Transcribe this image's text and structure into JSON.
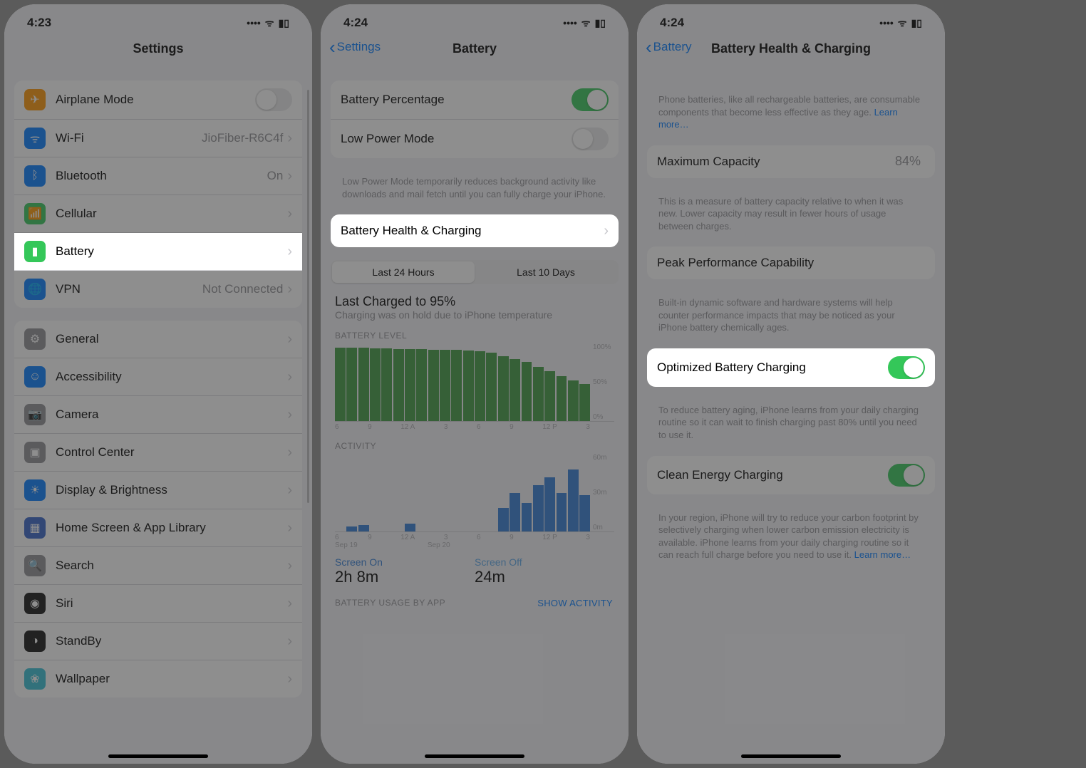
{
  "screen1": {
    "time": "4:23",
    "title": "Settings",
    "group1": [
      {
        "name": "airplane",
        "label": "Airplane Mode",
        "iconBg": "#ff9500",
        "glyph": "✈",
        "type": "toggle",
        "on": false
      },
      {
        "name": "wifi",
        "label": "Wi-Fi",
        "iconBg": "#007aff",
        "glyph": "ᯤ",
        "value": "JioFiber-R6C4f"
      },
      {
        "name": "bluetooth",
        "label": "Bluetooth",
        "iconBg": "#007aff",
        "glyph": "ᛒ",
        "value": "On"
      },
      {
        "name": "cellular",
        "label": "Cellular",
        "iconBg": "#34c759",
        "glyph": "📶"
      },
      {
        "name": "battery",
        "label": "Battery",
        "iconBg": "#34c759",
        "glyph": "▮",
        "highlight": true
      },
      {
        "name": "vpn",
        "label": "VPN",
        "iconBg": "#007aff",
        "glyph": "🌐",
        "value": "Not Connected"
      }
    ],
    "group2": [
      {
        "name": "general",
        "label": "General",
        "iconBg": "#8e8e93",
        "glyph": "⚙"
      },
      {
        "name": "accessibility",
        "label": "Accessibility",
        "iconBg": "#007aff",
        "glyph": "☺"
      },
      {
        "name": "camera",
        "label": "Camera",
        "iconBg": "#8e8e93",
        "glyph": "📷"
      },
      {
        "name": "control-center",
        "label": "Control Center",
        "iconBg": "#8e8e93",
        "glyph": "▣"
      },
      {
        "name": "display",
        "label": "Display & Brightness",
        "iconBg": "#007aff",
        "glyph": "☀"
      },
      {
        "name": "home-screen",
        "label": "Home Screen & App Library",
        "iconBg": "#3463c7",
        "glyph": "▦"
      },
      {
        "name": "search",
        "label": "Search",
        "iconBg": "#8e8e93",
        "glyph": "🔍"
      },
      {
        "name": "siri",
        "label": "Siri",
        "iconBg": "#111",
        "glyph": "◉"
      },
      {
        "name": "standby",
        "label": "StandBy",
        "iconBg": "#111",
        "glyph": "◑"
      },
      {
        "name": "wallpaper",
        "label": "Wallpaper",
        "iconBg": "#33bed4",
        "glyph": "❀"
      }
    ]
  },
  "screen2": {
    "time": "4:24",
    "back": "Settings",
    "title": "Battery",
    "rows": {
      "percentage": "Battery Percentage",
      "lowpower": "Low Power Mode",
      "lowpower_desc": "Low Power Mode temporarily reduces background activity like downloads and mail fetch until you can fully charge your iPhone.",
      "health": "Battery Health & Charging"
    },
    "segments": {
      "a": "Last 24 Hours",
      "b": "Last 10 Days"
    },
    "charge_head": "Last Charged to 95%",
    "charge_sub": "Charging was on hold due to iPhone temperature",
    "label_level": "BATTERY LEVEL",
    "label_activity": "ACTIVITY",
    "xticks": [
      "6",
      "9",
      "12 A",
      "3",
      "6",
      "9",
      "12 P",
      "3"
    ],
    "xticks2": [
      "6",
      "9",
      "12 A",
      "3",
      "6",
      "9",
      "12 P",
      "3"
    ],
    "xsub": [
      "Sep 19",
      "Sep 20"
    ],
    "y_level": [
      "100%",
      "50%",
      "0%"
    ],
    "y_act": [
      "60m",
      "30m",
      "0m"
    ],
    "screen_on_k": "Screen On",
    "screen_on_v": "2h 8m",
    "screen_off_k": "Screen Off",
    "screen_off_v": "24m",
    "usage_label": "BATTERY USAGE BY APP",
    "show_activity": "SHOW ACTIVITY"
  },
  "screen3": {
    "time": "4:24",
    "back": "Battery",
    "title": "Battery Health & Charging",
    "intro": "Phone batteries, like all rechargeable batteries, are consumable components that become less effective as they age. ",
    "learn": "Learn more…",
    "maxcap_label": "Maximum Capacity",
    "maxcap_value": "84%",
    "maxcap_desc": "This is a measure of battery capacity relative to when it was new. Lower capacity may result in fewer hours of usage between charges.",
    "peak_label": "Peak Performance Capability",
    "peak_desc": "Built-in dynamic software and hardware systems will help counter performance impacts that may be noticed as your iPhone battery chemically ages.",
    "opt_label": "Optimized Battery Charging",
    "opt_desc": "To reduce battery aging, iPhone learns from your daily charging routine so it can wait to finish charging past 80% until you need to use it.",
    "clean_label": "Clean Energy Charging",
    "clean_desc": "In your region, iPhone will try to reduce your carbon footprint by selectively charging when lower carbon emission electricity is available. iPhone learns from your daily charging routine so it can reach full charge before you need to use it. "
  },
  "chart_data": [
    {
      "type": "bar",
      "title": "BATTERY LEVEL",
      "ylabel": "%",
      "ylim": [
        0,
        100
      ],
      "x": [
        "6",
        "7",
        "8",
        "9",
        "10",
        "11",
        "12 A",
        "1",
        "2",
        "3",
        "4",
        "5",
        "6",
        "7",
        "8",
        "9",
        "10",
        "11",
        "12 P",
        "1",
        "2",
        "3"
      ],
      "values": [
        95,
        95,
        95,
        94,
        94,
        93,
        93,
        93,
        92,
        92,
        92,
        91,
        90,
        88,
        84,
        80,
        76,
        70,
        64,
        58,
        52,
        48
      ]
    },
    {
      "type": "bar",
      "title": "ACTIVITY",
      "ylabel": "minutes",
      "ylim": [
        0,
        60
      ],
      "x": [
        "6",
        "7",
        "8",
        "9",
        "10",
        "11",
        "12 A",
        "1",
        "2",
        "3",
        "4",
        "5",
        "6",
        "7",
        "8",
        "9",
        "10",
        "11",
        "12 P",
        "1",
        "2",
        "3"
      ],
      "values": [
        0,
        4,
        5,
        0,
        0,
        0,
        6,
        0,
        0,
        0,
        0,
        0,
        0,
        0,
        18,
        30,
        22,
        36,
        42,
        30,
        48,
        28
      ]
    }
  ]
}
